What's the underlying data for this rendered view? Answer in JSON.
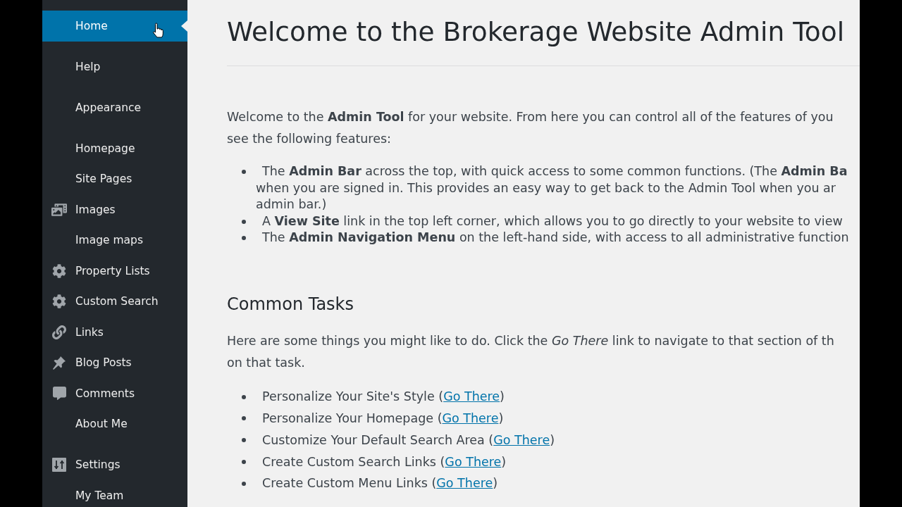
{
  "sidebar": {
    "groups": [
      {
        "items": [
          {
            "label": "Home",
            "selected": true
          }
        ]
      },
      {
        "items": [
          {
            "label": "Help",
            "selected": false
          }
        ]
      },
      {
        "items": [
          {
            "label": "Appearance",
            "selected": false
          }
        ]
      },
      {
        "items": [
          {
            "label": "Homepage",
            "selected": false
          },
          {
            "label": "Site Pages",
            "selected": false
          },
          {
            "label": "Images",
            "selected": false
          },
          {
            "label": "Image maps",
            "selected": false
          },
          {
            "label": "Property Lists",
            "selected": false
          },
          {
            "label": "Custom Search",
            "selected": false
          },
          {
            "label": "Links",
            "selected": false
          },
          {
            "label": "Blog Posts",
            "selected": false
          },
          {
            "label": "Comments",
            "selected": false
          },
          {
            "label": "About Me",
            "selected": false
          }
        ]
      },
      {
        "items": [
          {
            "label": "Settings",
            "selected": false
          },
          {
            "label": "My Team",
            "selected": false
          }
        ]
      }
    ]
  },
  "main": {
    "title": "Welcome to the Brokerage Website Admin Tool",
    "intro": {
      "lines": [
        "Welcome to the **Admin Tool** for your website. From here you can control all of the features of you",
        "see the following features:"
      ]
    },
    "features": [
      {
        "lines": [
          "The **Admin Bar** across the top, with quick access to some common functions. (The **Admin Ba**",
          "when you are signed in. This provides an easy way to get back to the Admin Tool when you ar",
          "admin bar.)"
        ]
      },
      {
        "lines": [
          "A **View Site** link in the top left corner, which allows you to go directly to your website to view"
        ]
      },
      {
        "lines": [
          "The **Admin Navigation Menu** on the left-hand side, with access to all administrative function"
        ]
      }
    ],
    "section_title": "Common Tasks",
    "tasks_intro": {
      "lines": [
        "Here are some things you might like to do. Click the *Go There* link to navigate to that section of th",
        "on that task."
      ]
    },
    "tasks": [
      {
        "text_before": "Personalize Your Site's Style (",
        "link": "Go There",
        "text_after": ")"
      },
      {
        "text_before": "Personalize Your Homepage (",
        "link": "Go There",
        "text_after": ")"
      },
      {
        "text_before": "Customize Your Default Search Area (",
        "link": "Go There",
        "text_after": ")"
      },
      {
        "text_before": "Create Custom Search Links (",
        "link": "Go There",
        "text_after": ")"
      },
      {
        "text_before": "Create Custom Menu Links (",
        "link": "Go There",
        "text_after": ")"
      }
    ]
  }
}
